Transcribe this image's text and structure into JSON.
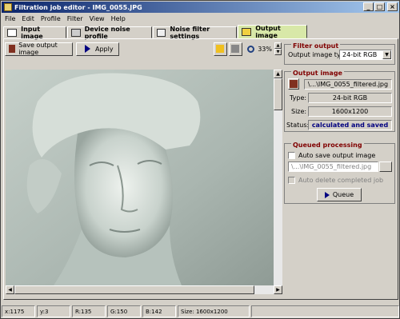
{
  "window": {
    "title": "Filtration job editor - IMG_0055.JPG"
  },
  "title_buttons": {
    "minimize": "_",
    "maximize": "□",
    "close": "×"
  },
  "menu": [
    "File",
    "Edit",
    "Profile",
    "Filter",
    "View",
    "Help"
  ],
  "tabs": [
    {
      "label": "Input image",
      "active": false
    },
    {
      "label": "Device noise profile",
      "active": false
    },
    {
      "label": "Noise filter settings",
      "active": false
    },
    {
      "label": "Output image",
      "active": true
    }
  ],
  "toolbar": {
    "save_label": "Save output image",
    "apply_label": "Apply",
    "zoom": "33%"
  },
  "filter_output": {
    "title": "Filter output",
    "type_label": "Output image type:",
    "type_value": "24-bit RGB"
  },
  "output_image": {
    "title": "Output image",
    "filename": "\\...\\IMG_0055_filtered.jpg",
    "type_label": "Type:",
    "type_value": "24-bit RGB",
    "size_label": "Size:",
    "size_value": "1600x1200",
    "status_label": "Status:",
    "status_value": "calculated and saved"
  },
  "queued": {
    "title": "Queued processing",
    "auto_save_label": "Auto save output image",
    "path_value": "\\...\\IMG_0055_filtered.jpg",
    "auto_delete_label": "Auto delete completed job",
    "queue_label": "Queue"
  },
  "statusbar": {
    "x": "x:1175",
    "y": "y:3",
    "r": "R:135",
    "g": "G:150",
    "b": "B:142",
    "size": "Size: 1600x1200"
  },
  "colors": {
    "accent_title": "#800000",
    "status_text": "#000080",
    "active_tab": "#d8e8a8"
  }
}
